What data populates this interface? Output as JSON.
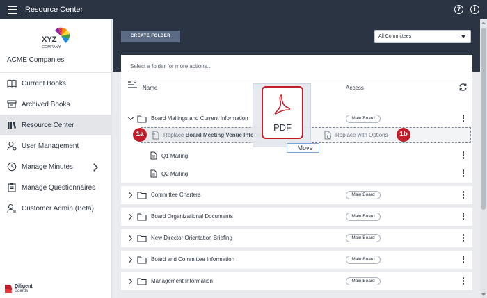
{
  "app": {
    "title": "Resource Center"
  },
  "topbar": {
    "help_icon": "?",
    "info_icon": "i"
  },
  "sidebar": {
    "logo": {
      "text": "XYZ",
      "subtext": "COMPANY"
    },
    "org_name": "ACME Companies",
    "items": [
      {
        "label": "Current Books",
        "icon": "book-icon",
        "active": false
      },
      {
        "label": "Archived Books",
        "icon": "archive-icon",
        "active": false
      },
      {
        "label": "Resource Center",
        "icon": "library-icon",
        "active": true
      },
      {
        "label": "User Management",
        "icon": "user-gear-icon",
        "active": false
      },
      {
        "label": "Manage Minutes",
        "icon": "clock-icon",
        "active": false
      },
      {
        "label": "Manage Questionnaires",
        "icon": "clipboard-icon",
        "active": false
      },
      {
        "label": "Customer Admin (Beta)",
        "icon": "admin-icon",
        "active": false
      }
    ],
    "brand": {
      "name": "Diligent",
      "product": "Boards"
    }
  },
  "toolbar": {
    "create_folder_label": "CREATE FOLDER",
    "committee_filter": "All Committees"
  },
  "list": {
    "hint": "Select a folder for more actions...",
    "columns": {
      "name": "Name",
      "access": "Access"
    },
    "expanded_folder": {
      "name": "Board Mailings and Current Information",
      "access": "Main Board",
      "files": [
        {
          "name": "Q1 Mailing"
        },
        {
          "name": "Q2 Mailing"
        }
      ]
    },
    "drop_options": {
      "replace_prefix": "Replace",
      "replace_target": "Board Meeting Venue Informati",
      "replace_with_options": "Replace with Options",
      "marker_a": "1a",
      "marker_b": "1b"
    },
    "folders": [
      {
        "name": "Committee Charters",
        "access": "Main Board"
      },
      {
        "name": "Board Organizational Documents",
        "access": "Main Board"
      },
      {
        "name": "New Director Orientation Briefing",
        "access": "Main Board"
      },
      {
        "name": "Board and Committee Information",
        "access": "Main Board"
      },
      {
        "name": "Management Information",
        "access": "Main Board"
      }
    ]
  },
  "drag": {
    "file_type": "PDF",
    "action": "Move"
  },
  "colors": {
    "header": "#2b3443",
    "accent_red": "#c11d2a",
    "button": "#5b6b84"
  }
}
